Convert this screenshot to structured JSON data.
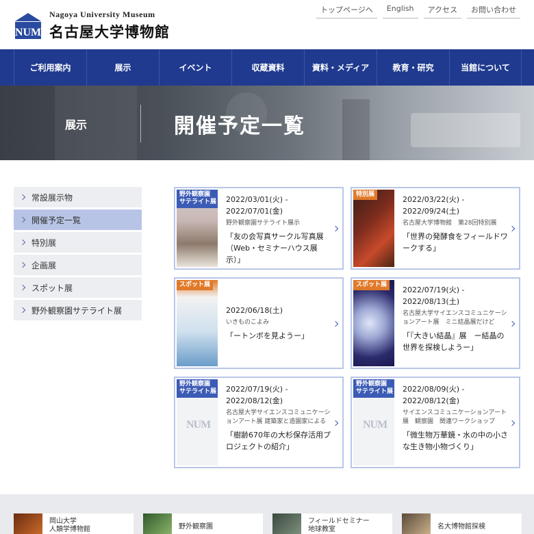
{
  "header": {
    "logo_en": "Nagoya University Museum",
    "logo_jp": "名古屋大学博物館",
    "logo_mark": "NUM",
    "util_links": [
      "トップページへ",
      "English",
      "アクセス",
      "お問い合わせ"
    ]
  },
  "nav": [
    "ご利用案内",
    "展示",
    "イベント",
    "収蔵資料",
    "資料・メディア",
    "教育・研究",
    "当館について"
  ],
  "hero": {
    "section": "展示",
    "title": "開催予定一覧"
  },
  "sidebar": {
    "items": [
      "常設展示物",
      "開催予定一覧",
      "特別展",
      "企画展",
      "スポット展",
      "野外観察園サテライト展"
    ],
    "active_index": 1
  },
  "cards": [
    {
      "tag": "野外観察園\nサテライト展",
      "date": "2022/03/01(火) - 2022/07/01(金)",
      "org": "野外観察園サテライト展示",
      "title": "「友の会写真サークル写真展（Web・セミナーハウス展示）」"
    },
    {
      "tag": "特別展",
      "date": "2022/03/22(火) - 2022/09/24(土)",
      "org": "名古屋大学博物館　第28回特別展",
      "title": "「世界の発酵食をフィールドワークする」"
    },
    {
      "tag": "スポット展",
      "date": "2022/06/18(土)",
      "org": "いきものこよみ",
      "title": "「ートンボを見ようー」"
    },
    {
      "tag": "スポット展",
      "date": "2022/07/19(火) - 2022/08/13(土)",
      "org": "名古屋大学サイエンスコミュニケーションアート展　ミニ結晶展だけど",
      "title": "「『大きい結晶』展　ー結晶の世界を探検しようー」"
    },
    {
      "tag": "野外観察園\nサテライト展",
      "date": "2022/07/19(火) - 2022/08/12(金)",
      "org": "名古屋大学サイエンスコミュニケーションアート展 建築家と造園家による",
      "title": "「樹齢670年の大杉保存活用プロジェクトの紹介」"
    },
    {
      "tag": "野外観察園\nサテライト展",
      "date": "2022/08/09(火) - 2022/08/12(金)",
      "org": "サイエンスコミュニケーションアート展　観察園　関連ワークショップ",
      "title": "「微生物万華鏡・水の中の小さな生き物小物づくり」"
    }
  ],
  "footer_banners": [
    "岡山大学\n人類学博物館",
    "野外観察園",
    "フィールドセミナー\n地球教室",
    "名大博物館探検"
  ]
}
